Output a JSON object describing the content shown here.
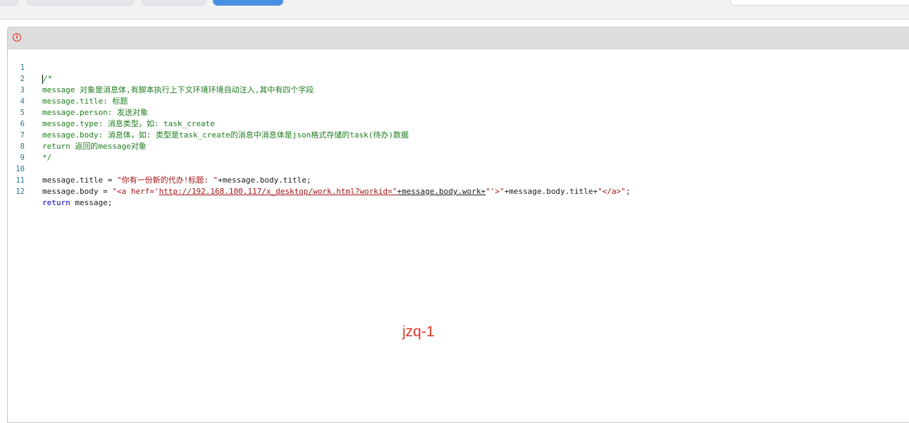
{
  "editor": {
    "lines": [
      {
        "num": "1",
        "text": "/*"
      },
      {
        "num": "2",
        "text": "message 对象是消息体,有脚本执行上下文环境环境自动注入,其中有四个字段"
      },
      {
        "num": "3",
        "text": "message.title: 标题"
      },
      {
        "num": "4",
        "text": "message.person: 发送对象"
      },
      {
        "num": "5",
        "text": "message.type: 消息类型，如: task_create"
      },
      {
        "num": "6",
        "text": "message.body: 消息体，如: 类型是task_create的消息中消息体是json格式存储的task(待办)数据"
      },
      {
        "num": "7",
        "text": "return 返回的message对象"
      },
      {
        "num": "8",
        "text": "*/"
      },
      {
        "num": "9",
        "text": ""
      },
      {
        "num": "10",
        "parts": [
          "message.title = ",
          "\"你有一份新的代办!标题: \"",
          "+message.body.title;"
        ]
      },
      {
        "num": "11",
        "parts": [
          "message.body = ",
          "\"<a herf='",
          "http://192.168.100.117/x_desktop/work.html?workid=\"",
          "+message.body.work+",
          "\"'>\"",
          "+message.body.title+",
          "\"</a>\"",
          ";"
        ]
      },
      {
        "num": "12",
        "parts": [
          "return",
          " message;"
        ]
      }
    ]
  },
  "watermark": "jzq-1",
  "icons": {
    "error": "error-icon",
    "error_glyph": "i"
  },
  "colors": {
    "comment": "#1e7d1e",
    "string": "#a31515",
    "keyword": "#0000cc",
    "line_number": "#237893",
    "watermark": "#e03a2a"
  }
}
